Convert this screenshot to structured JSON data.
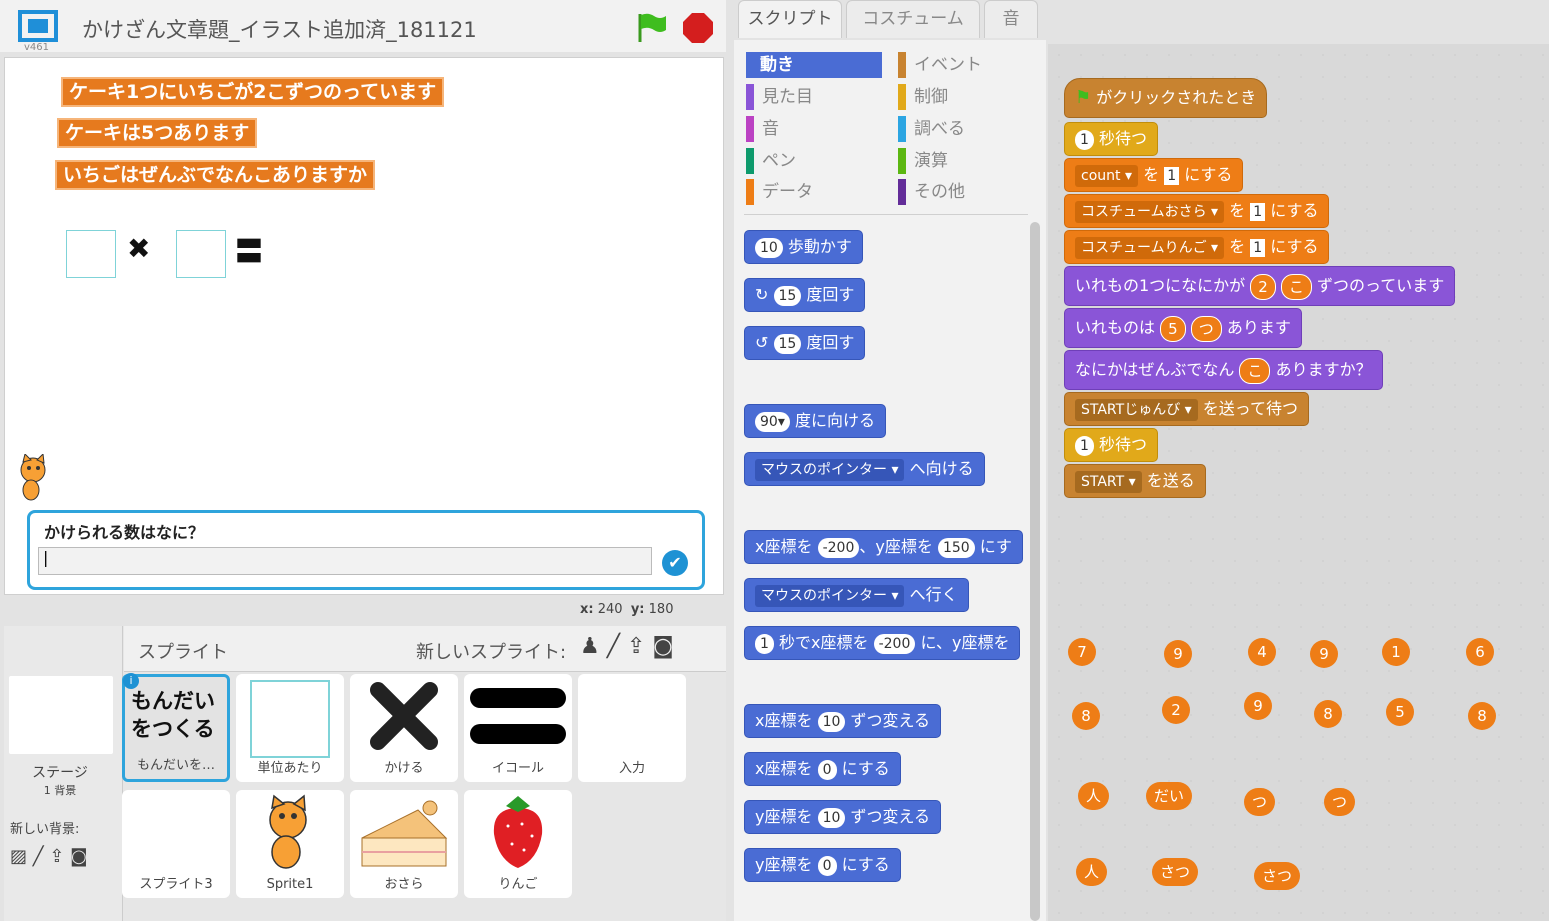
{
  "project": {
    "title": "かけざん文章題_イラスト追加済_181121",
    "version": "v461"
  },
  "stage": {
    "say_bubbles": [
      "ケーキ1つにいちごが2こずつのっています",
      "ケーキは5つあります",
      "いちごはぜんぶでなんこありますか"
    ],
    "times_symbol": "✖",
    "equals_symbol": "〓",
    "ask_question": "かけられる数はなに？",
    "ask_value": "|",
    "coords": {
      "x_label": "x:",
      "x_value": "240",
      "y_label": "y:",
      "y_value": "180"
    }
  },
  "sprite_panel": {
    "title": "スプライト",
    "new_sprite_label": "新しいスプライト:",
    "stage_tile": {
      "label": "ステージ",
      "backdrops": "1 背景",
      "new_backdrop": "新しい背景:"
    },
    "sprites": [
      {
        "label": "もんだいを…",
        "thumb_text": "もんだいをつくる",
        "selected": true
      },
      {
        "label": "単位あたり"
      },
      {
        "label": "かける"
      },
      {
        "label": "イコール"
      },
      {
        "label": "入力"
      },
      {
        "label": "スプライト3"
      },
      {
        "label": "Sprite1"
      },
      {
        "label": "おさら"
      },
      {
        "label": "りんご"
      }
    ]
  },
  "tabs": [
    "スクリプト",
    "コスチューム",
    "音"
  ],
  "categories": [
    {
      "label": "動き",
      "color": "#4a6cd4",
      "active": true
    },
    {
      "label": "イベント",
      "color": "#c88330"
    },
    {
      "label": "見た目",
      "color": "#8a55d7"
    },
    {
      "label": "制御",
      "color": "#e1a91a"
    },
    {
      "label": "音",
      "color": "#bb42c3"
    },
    {
      "label": "調べる",
      "color": "#2ca5e2"
    },
    {
      "label": "ペン",
      "color": "#0e9a6c"
    },
    {
      "label": "演算",
      "color": "#5cb712"
    },
    {
      "label": "データ",
      "color": "#ee7d16"
    },
    {
      "label": "その他",
      "color": "#632d99"
    }
  ],
  "palette_blocks": {
    "move": {
      "value": "10",
      "text": "歩動かす"
    },
    "turn_right": {
      "value": "15",
      "text": "度回す"
    },
    "turn_left": {
      "value": "15",
      "text": "度回す"
    },
    "point_dir": {
      "value": "90▾",
      "text": "度に向ける"
    },
    "point_towards": {
      "menu": "マウスのポインター ▾",
      "text": "へ向ける"
    },
    "goto_xy": {
      "t1": "x座標を",
      "x": "-200",
      "t2": "、y座標を",
      "y": "150",
      "t3": "にす"
    },
    "goto": {
      "menu": "マウスのポインター ▾",
      "text": "へ行く"
    },
    "glide": {
      "secs": "1",
      "t1": "秒でx座標を",
      "x": "-200",
      "t2": "に、y座標を"
    },
    "change_x": {
      "t1": "x座標を",
      "value": "10",
      "t2": "ずつ変える"
    },
    "set_x": {
      "t1": "x座標を",
      "value": "0",
      "t2": "にする"
    },
    "change_y": {
      "t1": "y座標を",
      "value": "10",
      "t2": "ずつ変える"
    },
    "set_y": {
      "t1": "y座標を",
      "value": "0",
      "t2": "にする"
    }
  },
  "script": {
    "hat": "がクリックされたとき",
    "wait1": {
      "value": "1",
      "text": "秒待つ"
    },
    "set_count": {
      "var": "count ▾",
      "t1": "を",
      "value": "1",
      "t2": "にする"
    },
    "set_costume1": {
      "var": "コスチュームおさら ▾",
      "t1": "を",
      "value": "1",
      "t2": "にする"
    },
    "set_costume2": {
      "var": "コスチュームりんご ▾",
      "t1": "を",
      "value": "1",
      "t2": "にする"
    },
    "look1": {
      "t1": "いれもの1つになにかが",
      "a": "2",
      "b": "こ",
      "t2": "ずつのっています"
    },
    "look2": {
      "t1": "いれものは",
      "a": "5",
      "b": "つ",
      "t2": "あります"
    },
    "look3": {
      "t1": "なにかはぜんぶでなん",
      "a": "こ",
      "t2": "ありますか？"
    },
    "broadcast_wait": {
      "msg": "STARTじゅんび ▾",
      "text": "を送って待つ"
    },
    "wait2": {
      "value": "1",
      "text": "秒待つ"
    },
    "broadcast": {
      "msg": "START ▾",
      "text": "を送る"
    }
  },
  "loose_reporters": {
    "row1": [
      "7",
      "9",
      "4",
      "9",
      "1",
      "6"
    ],
    "row2": [
      "8",
      "2",
      "9",
      "8",
      "5",
      "8"
    ],
    "row3": [
      "人",
      "だい",
      "つ",
      "つ"
    ],
    "row4": [
      "人",
      "さつ",
      "さつ"
    ]
  }
}
